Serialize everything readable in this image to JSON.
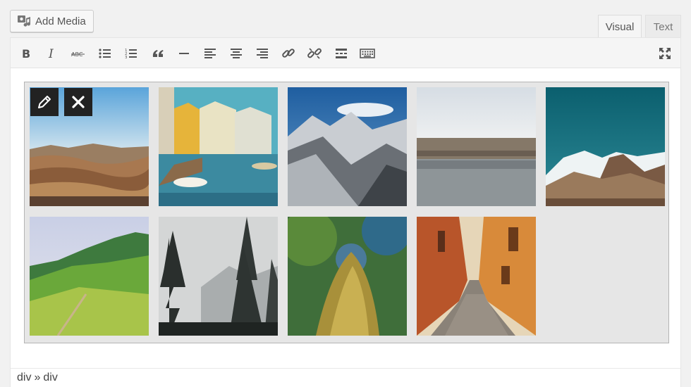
{
  "toolbar_top": {
    "add_media_label": "Add Media",
    "add_media_icon": "media-icon"
  },
  "tabs": [
    {
      "label": "Visual",
      "active": true
    },
    {
      "label": "Text",
      "active": false
    }
  ],
  "editor_toolbar": {
    "buttons": [
      {
        "name": "bold",
        "icon": "bold-icon"
      },
      {
        "name": "italic",
        "icon": "italic-icon"
      },
      {
        "name": "strikethrough",
        "icon": "strikethrough-icon",
        "label": "ABC"
      },
      {
        "name": "bulleted-list",
        "icon": "bullet-list-icon"
      },
      {
        "name": "numbered-list",
        "icon": "numbered-list-icon"
      },
      {
        "name": "blockquote",
        "icon": "quote-icon"
      },
      {
        "name": "horizontal-line",
        "icon": "horizontal-line-icon"
      },
      {
        "name": "align-left",
        "icon": "align-left-icon"
      },
      {
        "name": "align-center",
        "icon": "align-center-icon"
      },
      {
        "name": "align-right",
        "icon": "align-right-icon"
      },
      {
        "name": "insert-link",
        "icon": "link-icon"
      },
      {
        "name": "remove-link",
        "icon": "unlink-icon"
      },
      {
        "name": "insert-more",
        "icon": "read-more-icon"
      },
      {
        "name": "toolbar-toggle",
        "icon": "keyboard-icon"
      },
      {
        "name": "fullscreen",
        "icon": "fullscreen-icon"
      }
    ]
  },
  "gallery": {
    "actions": [
      {
        "name": "edit",
        "icon": "pencil-icon"
      },
      {
        "name": "remove",
        "icon": "close-icon"
      }
    ],
    "images": [
      {
        "subject": "desert canyon landscape",
        "colors": [
          "#6fb0dd",
          "#b88a5c"
        ]
      },
      {
        "subject": "canal town with boats",
        "colors": [
          "#4fb0c8",
          "#e0b84a"
        ]
      },
      {
        "subject": "snowy mountain ridge",
        "colors": [
          "#2f6ea8",
          "#8a8f95"
        ]
      },
      {
        "subject": "lake with rocky shore",
        "colors": [
          "#d7dde2",
          "#8a8a85"
        ]
      },
      {
        "subject": "mountains under teal sky",
        "colors": [
          "#0f6a7a",
          "#9a7a5c"
        ]
      },
      {
        "subject": "green hills meadow",
        "colors": [
          "#cfd6e6",
          "#6fae3e"
        ]
      },
      {
        "subject": "pine trees in fog",
        "colors": [
          "#c9cdd0",
          "#2e3432"
        ]
      },
      {
        "subject": "mossy tree trunk",
        "colors": [
          "#3f7fa0",
          "#b69a3a"
        ]
      },
      {
        "subject": "narrow cobblestone alley",
        "colors": [
          "#c6662e",
          "#8a8278"
        ]
      }
    ]
  },
  "statusbar": {
    "path": [
      "div",
      "div"
    ],
    "separator": "»"
  }
}
